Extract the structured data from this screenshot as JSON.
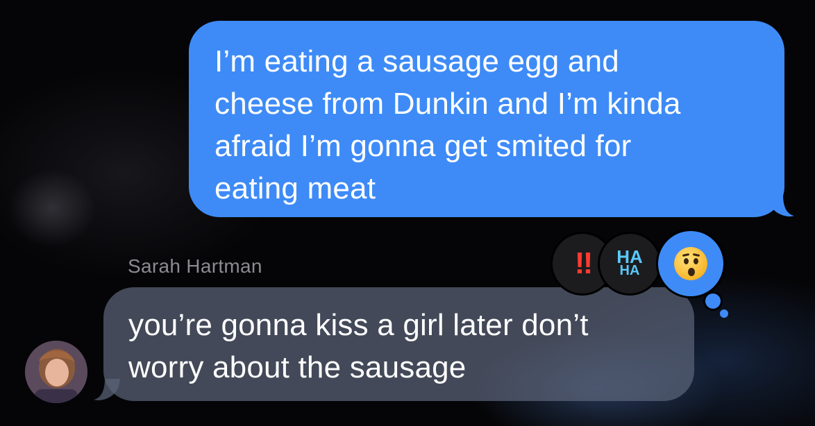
{
  "outgoing_message": {
    "line1": "I’m eating a sausage egg and",
    "line2": "cheese from Dunkin and I’m kinda",
    "line3": "afraid I’m gonna get smited for",
    "line4": "eating meat",
    "bubble_color": "#3e8bf7"
  },
  "incoming_message": {
    "sender": "Sarah Hartman",
    "line1": "you’re gonna kiss a girl later don’t",
    "line2": "worry about the sausage",
    "bubble_color": "#5c6478"
  },
  "tapbacks": {
    "exclaim": {
      "label": "‼",
      "icon": "double-exclamation-icon"
    },
    "haha": {
      "label_top": "HA",
      "label_bottom": "HA",
      "icon": "haha-icon"
    },
    "emoji": {
      "icon": "surprised-face-icon",
      "selected": true
    }
  }
}
